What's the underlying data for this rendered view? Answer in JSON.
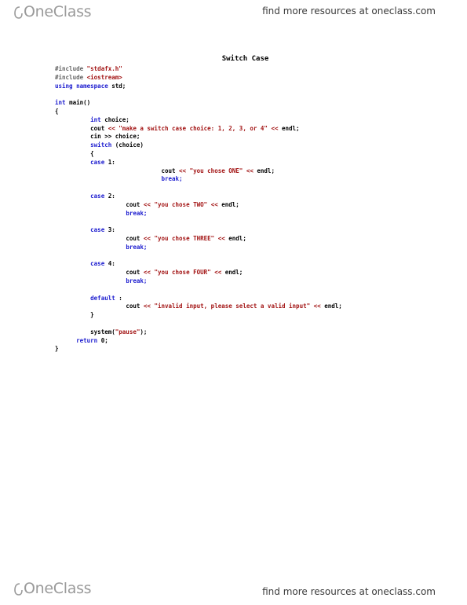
{
  "header": {
    "brand": "OneClass",
    "resources_link": "find more resources at oneclass.com"
  },
  "footer": {
    "brand": "OneClass",
    "resources_link": "find more resources at oneclass.com"
  },
  "document": {
    "title": "Switch Case"
  },
  "code": {
    "l1_kw": "#include",
    "l1_str": "\"stdafx.h\"",
    "l2_kw": "#include",
    "l2_str": "<iostream>",
    "l3_kw1": "using",
    "l3_kw2": "namespace",
    "l3_txt": "std;",
    "l5_kw": "int",
    "l5_txt": "main()",
    "l6": "{",
    "l7_kw": "int",
    "l7_txt": "choice;",
    "l8_txt": "cout",
    "l8_op": "<<",
    "l8_str": "\"make a switch case choice: 1, 2, 3, or 4\"",
    "l8_op2": "<<",
    "l8_end": "endl;",
    "l9_txt": "cin",
    "l9_op": ">>",
    "l9_end": "choice;",
    "l10_kw": "switch",
    "l10_txt": "(choice)",
    "l11": "{",
    "c1_kw": "case",
    "c1_num": "1:",
    "c1_cout": "cout",
    "c1_op": "<<",
    "c1_str": "\"you chose ONE\"",
    "c1_op2": "<<",
    "c1_end": "endl;",
    "c1_break": "break;",
    "c2_kw": "case",
    "c2_num": "2:",
    "c2_cout": "cout",
    "c2_op": "<<",
    "c2_str": "\"you chose TWO\"",
    "c2_op2": "<<",
    "c2_end": "endl;",
    "c2_break": "break;",
    "c3_kw": "case",
    "c3_num": "3:",
    "c3_cout": "cout",
    "c3_op": "<<",
    "c3_str": "\"you chose THREE\"",
    "c3_op2": "<<",
    "c3_end": "endl;",
    "c3_break": "break;",
    "c4_kw": "case",
    "c4_num": "4:",
    "c4_cout": "cout",
    "c4_op": "<<",
    "c4_str": "\"you chose FOUR\"",
    "c4_op2": "<<",
    "c4_end": "endl;",
    "c4_break": "break;",
    "d_kw": "default",
    "d_colon": ":",
    "d_cout": "cout",
    "d_op": "<<",
    "d_str": "\"invalid input, please select a valid input\"",
    "d_op2": "<<",
    "d_end": "endl;",
    "close_switch": "}",
    "sys_txt": "system(",
    "sys_str": "\"pause\"",
    "sys_end": ");",
    "ret_kw": "return",
    "ret_txt": "0;",
    "close_main": "}"
  }
}
